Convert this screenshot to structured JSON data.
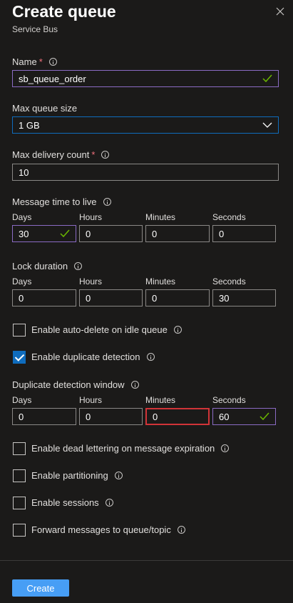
{
  "header": {
    "title": "Create queue",
    "subtitle": "Service Bus"
  },
  "name": {
    "label": "Name",
    "required": "*",
    "value": "sb_queue_order"
  },
  "max_queue_size": {
    "label": "Max queue size",
    "value": "1 GB"
  },
  "max_delivery_count": {
    "label": "Max delivery count",
    "required": "*",
    "value": "10"
  },
  "ttl": {
    "label": "Message time to live",
    "days_label": "Days",
    "hours_label": "Hours",
    "minutes_label": "Minutes",
    "seconds_label": "Seconds",
    "days": "30",
    "hours": "0",
    "minutes": "0",
    "seconds": "0"
  },
  "lock": {
    "label": "Lock duration",
    "days_label": "Days",
    "hours_label": "Hours",
    "minutes_label": "Minutes",
    "seconds_label": "Seconds",
    "days": "0",
    "hours": "0",
    "minutes": "0",
    "seconds": "30"
  },
  "auto_delete": {
    "label": "Enable auto-delete on idle queue",
    "checked": false
  },
  "duplicate_detection": {
    "label": "Enable duplicate detection",
    "checked": true
  },
  "dup_window": {
    "label": "Duplicate detection window",
    "days_label": "Days",
    "hours_label": "Hours",
    "minutes_label": "Minutes",
    "seconds_label": "Seconds",
    "days": "0",
    "hours": "0",
    "minutes": "0",
    "seconds": "60"
  },
  "dead_lettering": {
    "label": "Enable dead lettering on message expiration",
    "checked": false
  },
  "partitioning": {
    "label": "Enable partitioning",
    "checked": false
  },
  "sessions": {
    "label": "Enable sessions",
    "checked": false
  },
  "forward": {
    "label": "Forward messages to queue/topic",
    "checked": false
  },
  "footer": {
    "create_label": "Create"
  },
  "colors": {
    "accent": "#0f6cbd",
    "button": "#479ef5",
    "valid_border": "#8b6bc4",
    "error_border": "#d13438",
    "check_green": "#6bb700"
  }
}
